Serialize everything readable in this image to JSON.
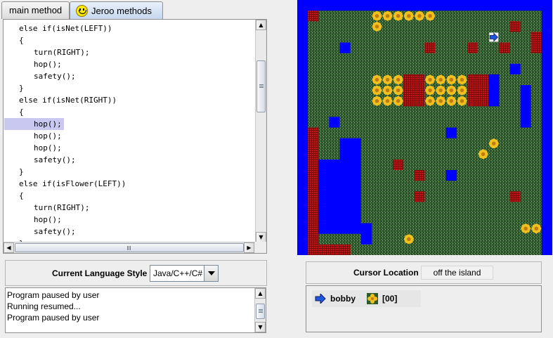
{
  "tabs": [
    {
      "label": "main method",
      "active": false
    },
    {
      "label": "Jeroo methods",
      "active": true,
      "icon": "smiley-icon"
    }
  ],
  "editor": {
    "lines": [
      {
        "text": "else if(isNet(LEFT))",
        "indent": 1,
        "highlighted": false
      },
      {
        "text": "{",
        "indent": 1,
        "highlighted": false
      },
      {
        "text": "turn(RIGHT);",
        "indent": 2,
        "highlighted": false
      },
      {
        "text": "hop();",
        "indent": 2,
        "highlighted": false
      },
      {
        "text": "safety();",
        "indent": 2,
        "highlighted": false
      },
      {
        "text": "}",
        "indent": 1,
        "highlighted": false
      },
      {
        "text": "else if(isNet(RIGHT))",
        "indent": 1,
        "highlighted": false
      },
      {
        "text": "{",
        "indent": 1,
        "highlighted": false
      },
      {
        "text": "hop();",
        "indent": 2,
        "highlighted": true
      },
      {
        "text": "hop();",
        "indent": 2,
        "highlighted": false
      },
      {
        "text": "hop();",
        "indent": 2,
        "highlighted": false
      },
      {
        "text": "safety();",
        "indent": 2,
        "highlighted": false
      },
      {
        "text": "}",
        "indent": 1,
        "highlighted": false
      },
      {
        "text": "else if(isFlower(LEFT))",
        "indent": 1,
        "highlighted": false
      },
      {
        "text": "{",
        "indent": 1,
        "highlighted": false
      },
      {
        "text": "turn(RIGHT);",
        "indent": 2,
        "highlighted": false
      },
      {
        "text": "hop();",
        "indent": 2,
        "highlighted": false
      },
      {
        "text": "safety();",
        "indent": 2,
        "highlighted": false
      },
      {
        "text": "}",
        "indent": 1,
        "highlighted": false
      }
    ],
    "highlight_color": "#c8c8f0"
  },
  "language": {
    "label": "Current Language Style",
    "selected": "Java/C++/C#"
  },
  "console": {
    "lines": [
      "Program paused by user",
      "Running resumed...",
      "Program paused by user"
    ]
  },
  "cursor": {
    "label": "Cursor Location",
    "value": "off the island"
  },
  "jeroo_status": {
    "name": "bobby",
    "direction": "east",
    "direction_icon": "arrow-right-icon",
    "flower_icon": "flower-icon",
    "flowers": "[00]"
  },
  "island": {
    "columns": 24,
    "rows": 24,
    "legend": {
      "G": "grass",
      "W": "water",
      "N": "net",
      "F": "flower",
      "J": "jeroo"
    },
    "map": [
      "WWWWWWWWWWWWWWWWWWWWWWWW",
      "WNGGGGGFFFFFFGGGGGGGGGGW",
      "WGGGGGGFGGGGGGGGGGGGNGGW",
      "WGGGGGGGGGGGGGGGGGJGGGNW",
      "WGGGWGGGGGGGNGGGNGGNGGNW",
      "WGGGGGGGGGGGGGGGGGGGGGGW",
      "WGGGGGGGGGGGGGGGGGGGWGGW",
      "WGGGGGGFFFNNFFFFNNWGGGGW",
      "WGGGGGGFFFNNFFFFNNWGGWGW",
      "WGGGGGGFFFNNFFFFNNWGGWGW",
      "WGGGGGGGGGGGGGGGGGGGGWGW",
      "WGGWGGGGGGGGGGGGGGGGGWGW",
      "WNGGGGGGGGGGGGWGGGGGGGGW",
      "WNGGWWGGGGGGGGGGGGFGGGGW",
      "WNGGWWGGGGGGGGGGGFGGGGGW",
      "WNWWWWGGGNGGGGGGGGGGGGGW",
      "WNWWWWGGGGGNGGWGGGGGGGGW",
      "WNWWWWGGGGGGGGGGGGGGGGGW",
      "WNWWWWGGGGGNGGGGGGGGNGGW",
      "WNWWWWGGGGGGGGGGGGGGGGGW",
      "WNWWWWGGGGGGGGGGGGGGGGGW",
      "WNWWWWWGGGGGGGGGGGGGGFFW",
      "WNGGGGWGGGFGGGGGGGGGGGGW",
      "WNNNNGGGGGGGGGGGGGGGGGGW"
    ]
  }
}
